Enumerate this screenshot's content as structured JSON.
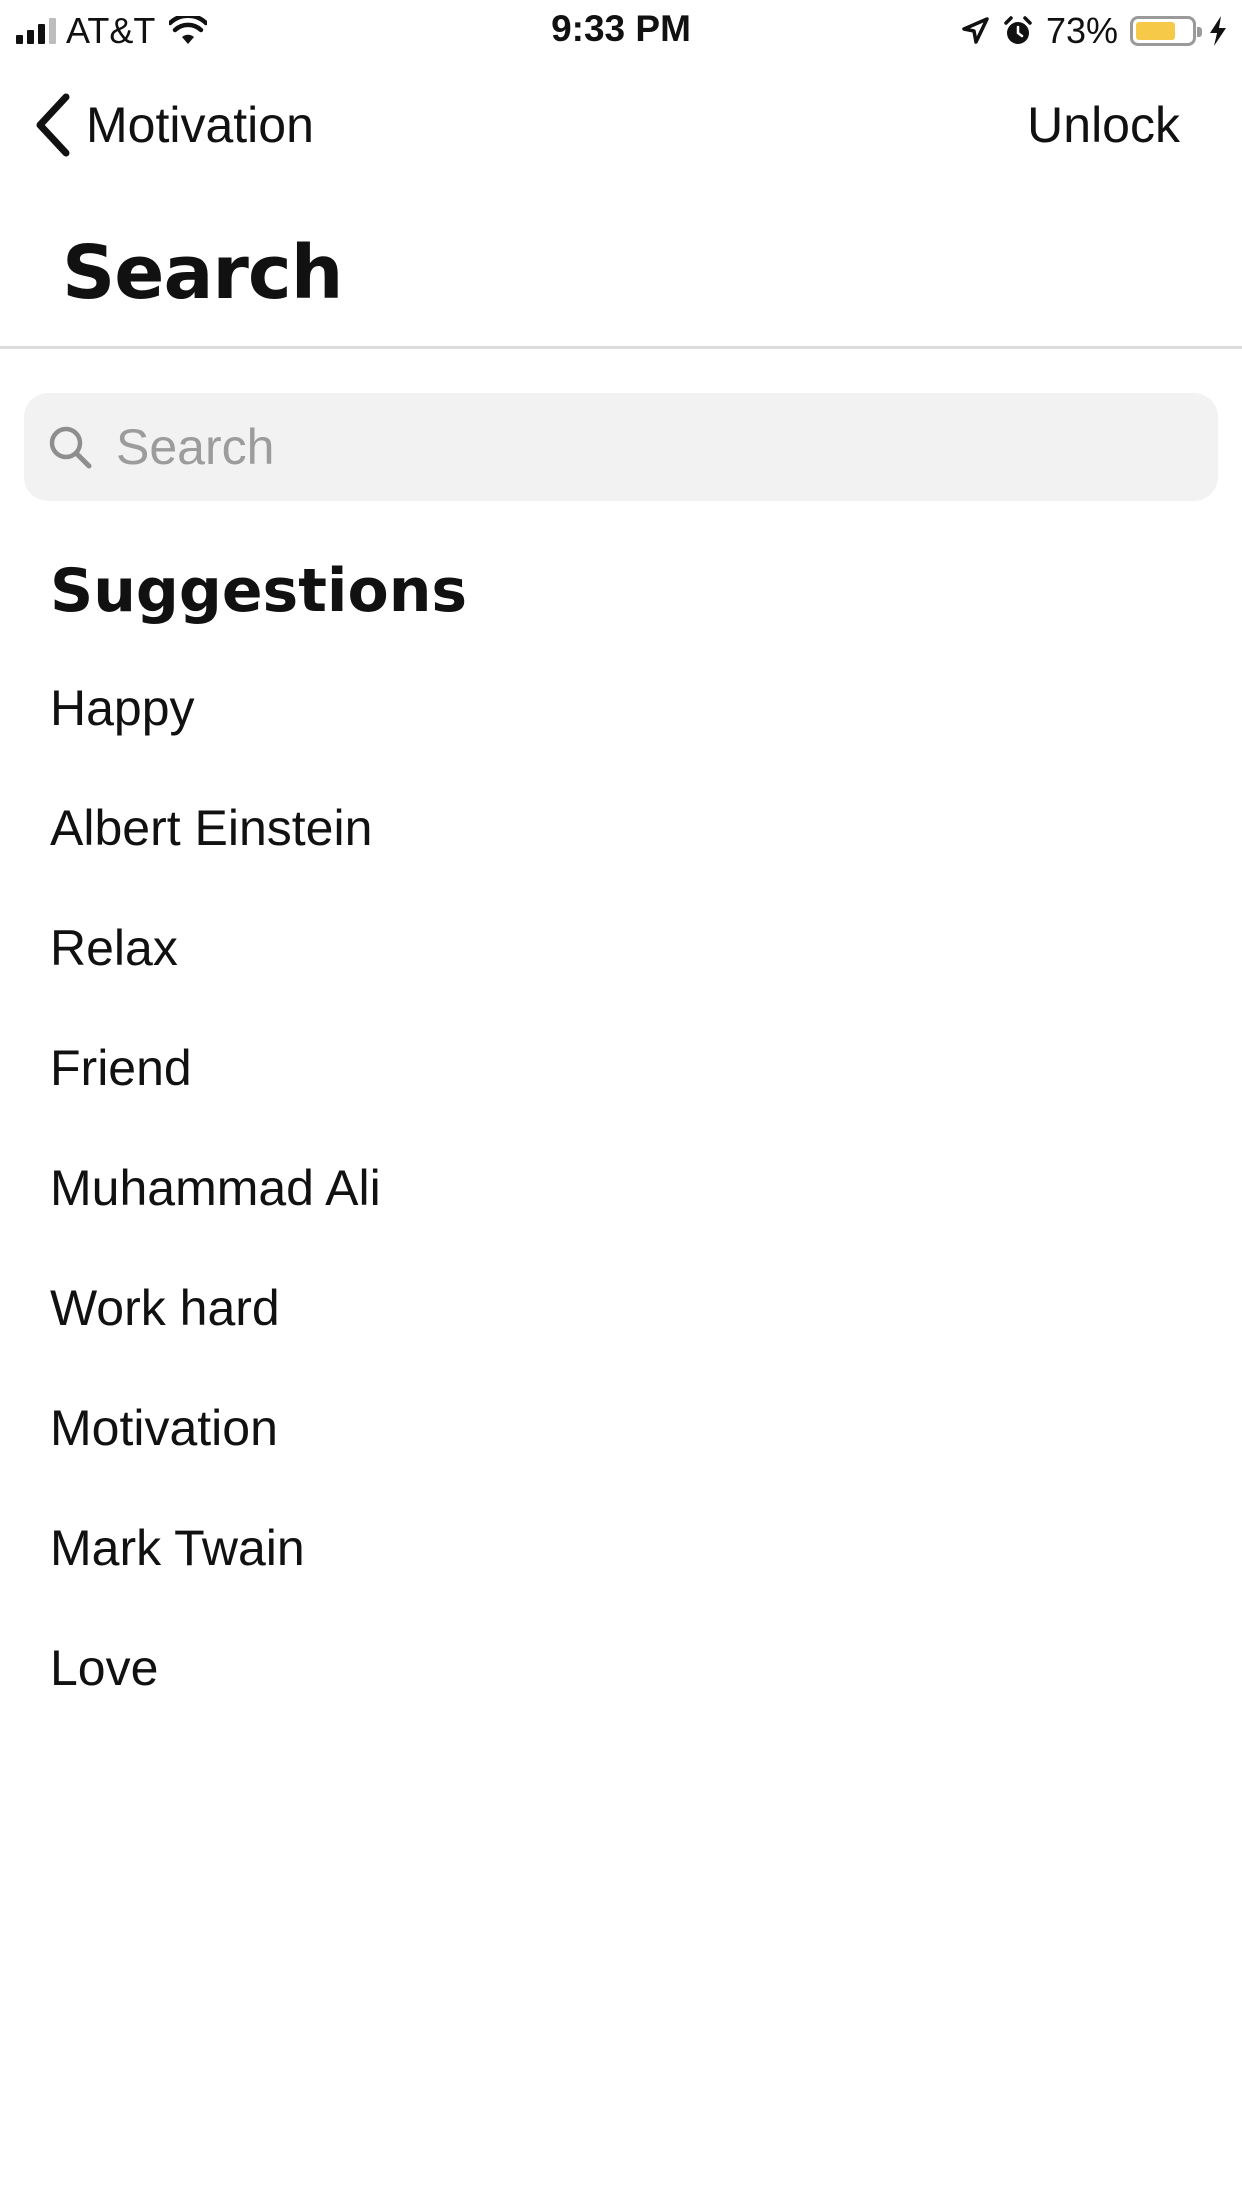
{
  "status_bar": {
    "carrier": "AT&T",
    "time": "9:33 PM",
    "battery_percent": "73%",
    "battery_level": 0.73,
    "battery_color": "#f7c948",
    "icons": [
      "signal-icon",
      "wifi-icon",
      "location-icon",
      "alarm-icon",
      "battery-icon",
      "charging-icon"
    ]
  },
  "nav": {
    "back_label": "Motivation",
    "back_icon": "chevron-left-icon",
    "unlock_label": "Unlock"
  },
  "page": {
    "title": "Search"
  },
  "search": {
    "placeholder": "Search",
    "value": "",
    "icon": "search-icon"
  },
  "suggestions": {
    "heading": "Suggestions",
    "items": [
      "Happy",
      "Albert Einstein",
      "Relax",
      "Friend",
      "Muhammad Ali",
      "Work hard",
      "Motivation",
      "Mark Twain",
      "Love"
    ]
  }
}
